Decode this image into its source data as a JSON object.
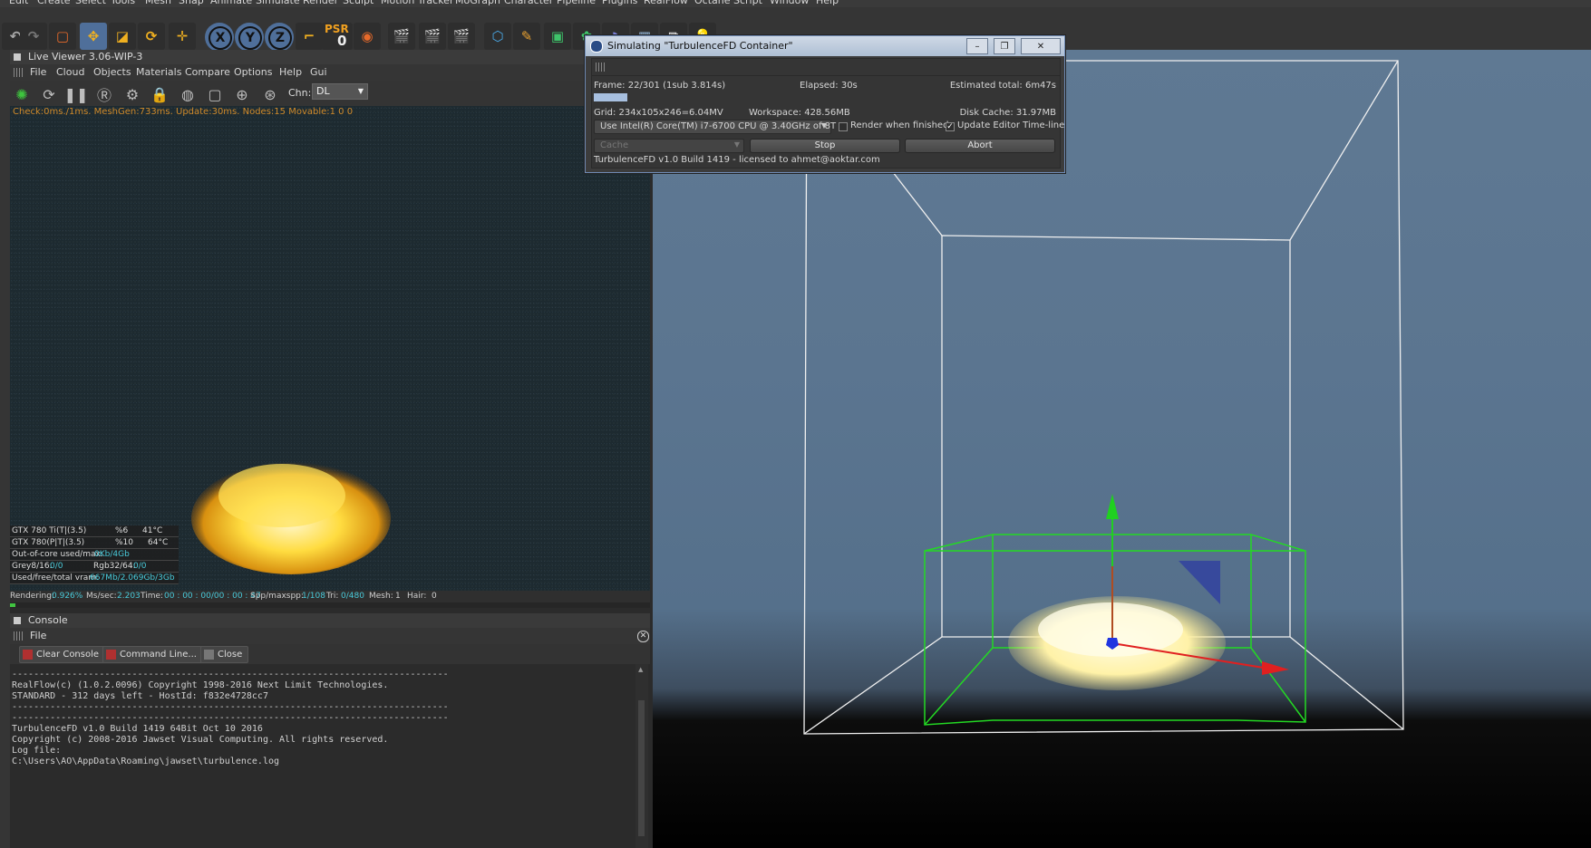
{
  "main_menu": [
    "Edit",
    "Create",
    "Select",
    "Tools",
    "Mesh",
    "Snap",
    "Animate",
    "Simulate",
    "Render",
    "Sculpt",
    "Motion Tracker",
    "MoGraph",
    "Character",
    "Pipeline",
    "Plugins",
    "RealFlow",
    "Octane",
    "Script",
    "Window",
    "Help"
  ],
  "toolbar": {
    "axis_x": "X",
    "axis_y": "Y",
    "axis_z": "Z",
    "psr_label": "PSR",
    "psr_value": "0"
  },
  "live_viewer": {
    "title": "Live Viewer 3.06-WIP-3",
    "menu": [
      "File",
      "Cloud",
      "Objects",
      "Materials",
      "Compare",
      "Options",
      "Help",
      "Gui"
    ],
    "channel_label": "Chn:",
    "channel_value": "DL",
    "status_top": "Check:0ms./1ms. MeshGen:733ms. Update:30ms. Nodes:15 Movable:1  0 0",
    "gpus": [
      {
        "name": "GTX 780 Ti(T|(3.5)",
        "load": "%6",
        "temp": "41°C"
      },
      {
        "name": "GTX 780(P|T|(3.5)",
        "load": "%10",
        "temp": "64°C"
      }
    ],
    "out_of_core_label": "Out-of-core used/max:",
    "out_of_core_value": "0Kb/4Gb",
    "grey_label": "Grey8/16:",
    "grey_value": "0/0",
    "rgb_label": "Rgb32/64:",
    "rgb_value": "0/0",
    "vram_label": "Used/free/total vram:",
    "vram_value": "667Mb/2.069Gb/3Gb",
    "render_bar": {
      "rendering_label": "Rendering:",
      "rendering_value": "0.926%",
      "mssec_label": "Ms/sec:",
      "mssec_value": "2.203",
      "time_label": "Time:",
      "time_value": "00 : 00 : 00/00 : 00 : 47",
      "spp_label": "Spp/maxspp:",
      "spp_value": "1/108",
      "tri_label": "Tri:",
      "tri_value": "0/480",
      "mesh_label": "Mesh:",
      "mesh_value": "1",
      "hair_label": "Hair:",
      "hair_value": "0"
    },
    "progress_fraction": 0.009
  },
  "console": {
    "title": "Console",
    "menu_file": "File",
    "btn_clear": "Clear Console",
    "btn_command": "Command Line...",
    "btn_close": "Close",
    "lines": [
      "--------------------------------------------------------------------------------",
      "RealFlow(c) (1.0.2.0096) Copyright 1998-2016 Next Limit Technologies.",
      "STANDARD - 312 days left - HostId: f832e4728cc7",
      "--------------------------------------------------------------------------------",
      "--------------------------------------------------------------------------------",
      "TurbulenceFD v1.0 Build 1419 64Bit Oct 10 2016",
      "Copyright (c) 2008-2016 Jawset Visual Computing. All rights reserved.",
      "Log file:",
      "C:\\Users\\AO\\AppData\\Roaming\\jawset\\turbulence.log"
    ]
  },
  "dialog": {
    "title": "Simulating \"TurbulenceFD Container\"",
    "frame": "Frame: 22/301 (1sub 3.814s)",
    "elapsed": "Elapsed: 30s",
    "estimated": "Estimated total: 6m47s",
    "progress_fraction": 0.073,
    "grid": "Grid: 234x105x246=6.04MV",
    "workspace": "Workspace: 428.56MB",
    "disk_cache": "Disk Cache: 31.97MB",
    "device": "Use  Intel(R) Core(TM) i7-6700 CPU @ 3.40GHz  of 8T",
    "render_when_finished": "Render when finished",
    "render_when_finished_checked": false,
    "update_timeline": "Update Editor Time-line",
    "update_timeline_checked": true,
    "cache": "Cache",
    "stop": "Stop",
    "abort": "Abort",
    "license": "TurbulenceFD v1.0 Build 1419 - licensed to ahmet@aoktar.com"
  },
  "colors": {
    "accent_blue": "#4f6f9a",
    "render_orange": "#d08a2a",
    "cyan": "#48c9d9",
    "progress_green": "#41c441",
    "bbox_green": "#23d923",
    "axis_red": "#e02020",
    "axis_green": "#20d020"
  }
}
